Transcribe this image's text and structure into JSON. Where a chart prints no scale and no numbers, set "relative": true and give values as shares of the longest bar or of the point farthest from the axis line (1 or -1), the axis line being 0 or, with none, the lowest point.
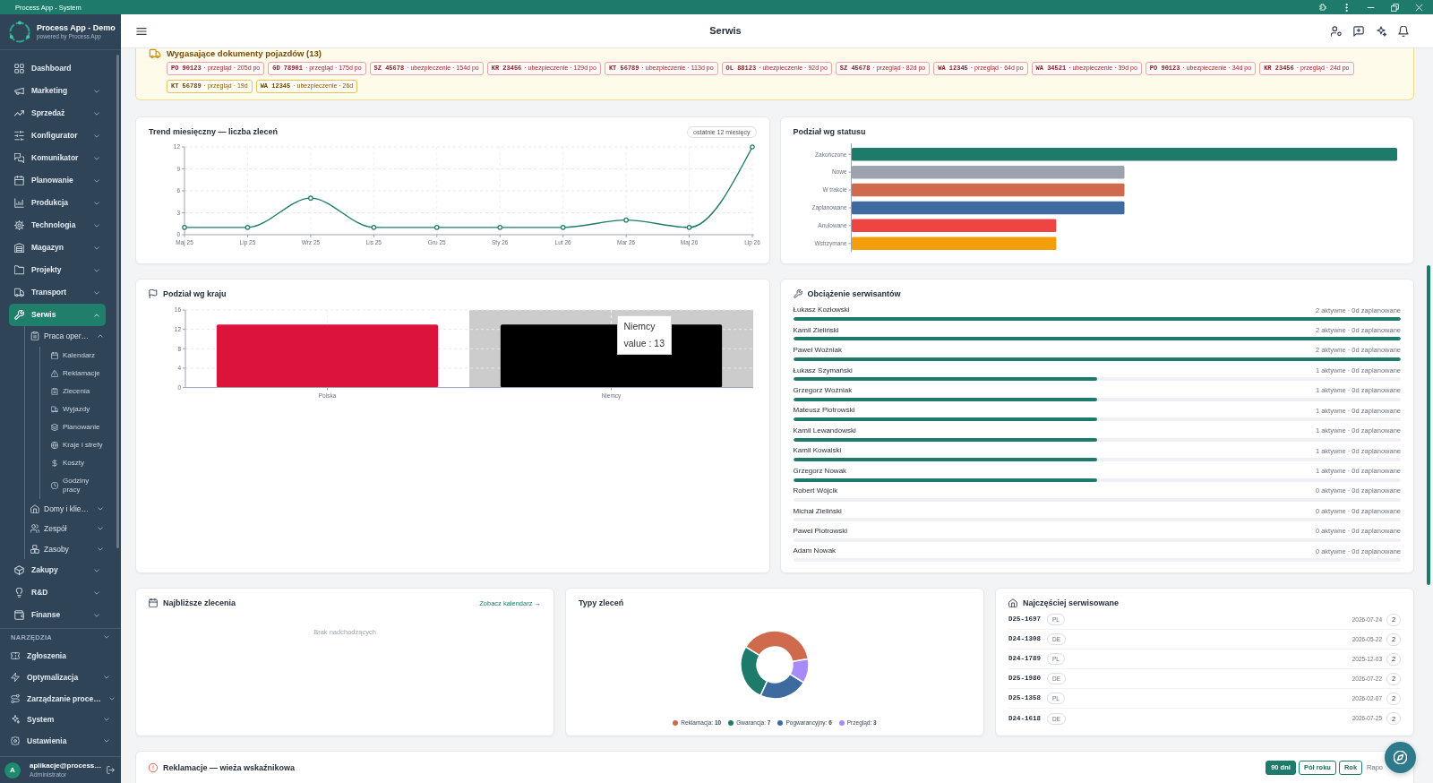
{
  "window": {
    "title": "Process App - System"
  },
  "sidebar": {
    "brand": {
      "name": "Process App - Demo",
      "tagline": "powered by Process App"
    },
    "sections": [
      {
        "items": [
          {
            "label": "Dashboard",
            "selected": false
          },
          {
            "label": "Marketing",
            "selected": false,
            "expanded": false
          },
          {
            "label": "Sprzedaż",
            "selected": false,
            "expanded": false
          },
          {
            "label": "Konfigurator",
            "selected": false,
            "expanded": false
          },
          {
            "label": "Komunikator",
            "selected": false,
            "expanded": false
          },
          {
            "label": "Planowanie",
            "selected": false,
            "expanded": false
          },
          {
            "label": "Produkcja",
            "selected": false,
            "expanded": false
          },
          {
            "label": "Technologia",
            "selected": false,
            "expanded": false
          },
          {
            "label": "Magazyn",
            "selected": false,
            "expanded": false
          },
          {
            "label": "Projekty",
            "selected": false,
            "expanded": false
          },
          {
            "label": "Transport",
            "selected": false,
            "expanded": false
          },
          {
            "label": "Serwis",
            "selected": true,
            "expanded": true,
            "children": [
              {
                "label": "Praca oper…",
                "selected": false,
                "expanded": true,
                "children": [
                  {
                    "label": "Kalendarz",
                    "selected": false
                  },
                  {
                    "label": "Reklamacje",
                    "selected": false
                  },
                  {
                    "label": "Zlecenia",
                    "selected": false
                  },
                  {
                    "label": "Wyjazdy",
                    "selected": false
                  },
                  {
                    "label": "Planowanie",
                    "selected": false
                  },
                  {
                    "label": "Kraje i strefy",
                    "selected": false
                  },
                  {
                    "label": "Koszty",
                    "selected": false
                  },
                  {
                    "label": "Godziny pracy",
                    "selected": false
                  }
                ]
              },
              {
                "label": "Domy i klie…",
                "selected": false,
                "expanded": false
              },
              {
                "label": "Zespół",
                "selected": false,
                "expanded": false
              },
              {
                "label": "Zasoby",
                "selected": false,
                "expanded": false
              }
            ]
          },
          {
            "label": "Zakupy",
            "selected": false,
            "expanded": false
          },
          {
            "label": "R&D",
            "selected": false,
            "expanded": false
          },
          {
            "label": "Finanse",
            "selected": false,
            "expanded": false
          }
        ]
      },
      {
        "title": "NARZĘDZIA",
        "expanded": false,
        "items": [
          {
            "label": "Zgłoszenia",
            "selected": false
          },
          {
            "label": "Optymalizacja",
            "selected": false,
            "expanded": false
          },
          {
            "label": "Zarządzanie proce…",
            "selected": false,
            "expanded": false
          },
          {
            "label": "System",
            "selected": false,
            "expanded": false
          },
          {
            "label": "Ustawienia",
            "selected": false,
            "expanded": false
          }
        ]
      }
    ],
    "user": {
      "initial": "A",
      "email": "aplikacje@process…",
      "role": "Administrator"
    }
  },
  "topbar": {
    "title": "Serwis"
  },
  "expiring_documents": {
    "title": "Wygasające dokumenty pojazdów (13)",
    "chips": [
      {
        "plate": "PO 90123",
        "text": "· przegląd · 205d po",
        "overdue": true
      },
      {
        "plate": "GD 78901",
        "text": "· przegląd · 175d po",
        "overdue": true
      },
      {
        "plate": "SZ 45678",
        "text": "· ubezpieczenie · 154d po",
        "overdue": true
      },
      {
        "plate": "KR 23456",
        "text": "· ubezpieczenie · 129d po",
        "overdue": true
      },
      {
        "plate": "KT 56789",
        "text": "· ubezpieczenie · 113d po",
        "overdue": true
      },
      {
        "plate": "OL 88123",
        "text": "· ubezpieczenie · 92d po",
        "overdue": true
      },
      {
        "plate": "SZ 45678",
        "text": "· przegląd · 82d po",
        "overdue": true
      },
      {
        "plate": "WA 12345",
        "text": "· przegląd · 64d po",
        "overdue": true
      },
      {
        "plate": "WA 34521",
        "text": "· ubezpieczenie · 39d po",
        "overdue": true
      },
      {
        "plate": "PO 90123",
        "text": "· ubezpieczenie · 34d po",
        "overdue": true
      },
      {
        "plate": "KR 23456",
        "text": "· przegląd · 24d po",
        "overdue": true
      },
      {
        "plate": "KT 56789",
        "text": "· przegląd · 19d",
        "overdue": false
      },
      {
        "plate": "WA 12345",
        "text": "· ubezpieczenie · 26d",
        "overdue": false
      }
    ]
  },
  "trend": {
    "title": "Trend miesięczny — liczba zleceń",
    "badge": "ostatnie 12 miesięcy",
    "chart_data": {
      "type": "line",
      "categories": [
        "Maj 25",
        "Lip 25",
        "Wrz 25",
        "Lis 25",
        "Gru 25",
        "Sty 26",
        "Lut 26",
        "Mar 26",
        "Maj 26",
        "Lip 26"
      ],
      "series": [
        {
          "color": "#1e7b6b",
          "marker": true,
          "values": [
            1,
            1,
            5,
            1,
            1,
            1,
            1,
            2,
            1,
            12
          ]
        }
      ],
      "ylim": [
        0,
        12
      ],
      "yticks": [
        0,
        3,
        6,
        9,
        12
      ],
      "grid": true
    }
  },
  "status": {
    "title": "Podział wg statusu",
    "chart_data": {
      "type": "bar",
      "orientation": "horizontal",
      "relative": true,
      "categories": [
        "Zakończone",
        "Nowe",
        "W trakcie",
        "Zaplanowane",
        "Anulowane",
        "Wstrzymane"
      ],
      "series": [
        {
          "values": [
            1,
            0.5,
            0.5,
            0.5,
            0.375,
            0.375
          ],
          "colors": [
            "#1e7b6b",
            "#9ca3af",
            "#cf6b4c",
            "#3d6b9f",
            "#ef4444",
            "#f59e0b"
          ]
        }
      ]
    }
  },
  "countries": {
    "title": "Podział wg kraju",
    "highlighted": [
      false,
      true
    ],
    "tooltip": {
      "title": "Niemcy",
      "text": "value : 13"
    },
    "chart_data": {
      "type": "bar",
      "orientation": "vertical",
      "categories": [
        "Polska",
        "Niemcy"
      ],
      "series": [
        {
          "values": [
            13,
            13
          ],
          "colors": [
            "#dc143c",
            "#000000"
          ]
        }
      ],
      "ylim": [
        0,
        16
      ],
      "yticks": [
        0,
        4,
        8,
        12,
        16
      ],
      "grid": true
    }
  },
  "workload": {
    "title": "Obciążenie serwisantów",
    "technicians": [
      {
        "name": "Łukasz Kozłowski",
        "reading": "2 aktywne · 0d zaplanowane",
        "level": 1
      },
      {
        "name": "Kamil Zieliński",
        "reading": "2 aktywne · 0d zaplanowane",
        "level": 1
      },
      {
        "name": "Paweł Woźniak",
        "reading": "2 aktywne · 0d zaplanowane",
        "level": 1
      },
      {
        "name": "Łukasz Szymański",
        "reading": "1 aktywne · 0d zaplanowane",
        "level": 0.5
      },
      {
        "name": "Grzegorz Woźniak",
        "reading": "1 aktywne · 0d zaplanowane",
        "level": 0.5
      },
      {
        "name": "Mateusz Piotrowski",
        "reading": "1 aktywne · 0d zaplanowane",
        "level": 0.5
      },
      {
        "name": "Kamil Lewandowski",
        "reading": "1 aktywne · 0d zaplanowane",
        "level": 0.5
      },
      {
        "name": "Kamil Kowalski",
        "reading": "1 aktywne · 0d zaplanowane",
        "level": 0.5
      },
      {
        "name": "Grzegorz Nowak",
        "reading": "1 aktywne · 0d zaplanowane",
        "level": 0.5
      },
      {
        "name": "Robert Wójcik",
        "reading": "0 aktywne · 0d zaplanowane",
        "level": 0
      },
      {
        "name": "Michał Zieliński",
        "reading": "0 aktywne · 0d zaplanowane",
        "level": 0
      },
      {
        "name": "Paweł Piotrowski",
        "reading": "0 aktywne · 0d zaplanowane",
        "level": 0
      },
      {
        "name": "Adam Nowak",
        "reading": "0 aktywne · 0d zaplanowane",
        "level": 0
      }
    ]
  },
  "upcoming": {
    "title": "Najbliższe zlecenia",
    "link": "Zobacz kalendarz →",
    "empty": "Brak nadchodzących"
  },
  "order_types": {
    "title": "Typy zleceń",
    "chart_data": {
      "type": "donut",
      "series": [
        {
          "values": [
            38.46,
            26.92,
            23.08,
            11.54
          ],
          "colors": [
            "#cf6b4c",
            "#1e7b6b",
            "#3d6b9f",
            "#a78bfa"
          ]
        }
      ]
    },
    "legend": [
      "Reklamacja: **10**",
      "Gwarancja: **7**",
      "Pogwarancyjny: **6**",
      "Przegląd: **3**"
    ]
  },
  "most_serviced": {
    "title": "Najczęściej serwisowane",
    "rows": [
      {
        "code": "D25-1697",
        "country": "PL",
        "date": "2026-07-24",
        "count": "2"
      },
      {
        "code": "D24-1308",
        "country": "DE",
        "date": "2026-05-22",
        "count": "2"
      },
      {
        "code": "D24-1789",
        "country": "PL",
        "date": "2025-12-03",
        "count": "2"
      },
      {
        "code": "D25-1980",
        "country": "DE",
        "date": "2026-07-22",
        "count": "2"
      },
      {
        "code": "D25-1358",
        "country": "PL",
        "date": "2026-02-07",
        "count": "2"
      },
      {
        "code": "D24-1618",
        "country": "DE",
        "date": "2026-07-25",
        "count": "2"
      }
    ]
  },
  "complaints": {
    "title": "Reklamacje — wieża wskaźnikowa",
    "ranges": [
      {
        "label": "90 dni",
        "selected": true
      },
      {
        "label": "Pół roku",
        "selected": false
      },
      {
        "label": "Rok",
        "selected": false
      }
    ],
    "extra_button": "Rapo"
  }
}
